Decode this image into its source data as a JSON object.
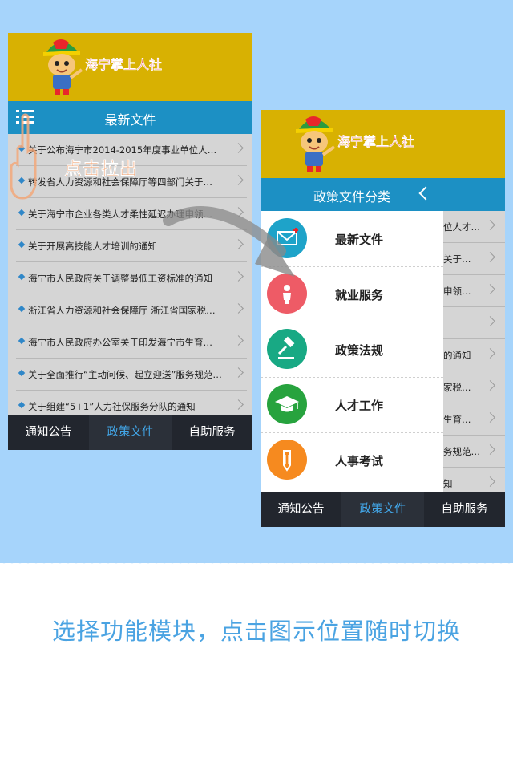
{
  "colors": {
    "background": "#a6d4fb",
    "titlebar": "#1c90c4",
    "banner": "#d8b102",
    "tabbar": "#22262e",
    "active_tab": "#42a6e8",
    "caption": "#4aa3e2"
  },
  "app_name": "海宁掌上人社",
  "phone1": {
    "title": "最新文件",
    "items": [
      "关于公布海宁市2014-2015年度事业单位人才…",
      "转发省人力资源和社会保障厅等四部门关于…",
      "关于海宁市企业各类人才柔性延迟办理申领…",
      "关于开展高技能人才培训的通知",
      "海宁市人民政府关于调整最低工资标准的通知",
      "浙江省人力资源和社会保障厅 浙江省国家税…",
      "海宁市人民政府办公室关于印发海宁市生育…",
      "关于全面推行“主动问候、起立迎送”服务规范…",
      "关于组建“5+1”人力社保服务分队的通知"
    ],
    "tabs": [
      "通知公告",
      "政策文件",
      "自助服务"
    ],
    "active_tab": "政策文件",
    "hint": "点击拉出"
  },
  "phone2": {
    "drawer_title": "政策文件分类",
    "categories": [
      {
        "label": "最新文件",
        "icon": "mail-icon",
        "color": "#1ea3c9"
      },
      {
        "label": "就业服务",
        "icon": "person-icon",
        "color": "#ee5b66"
      },
      {
        "label": "政策法规",
        "icon": "gavel-icon",
        "color": "#18a984"
      },
      {
        "label": "人才工作",
        "icon": "graduation-cap-icon",
        "color": "#27a33e"
      },
      {
        "label": "人事考试",
        "icon": "pencil-icon",
        "color": "#f68a1f"
      }
    ],
    "peek_items": [
      "位人才…",
      "关于…",
      "申领…",
      "",
      "的通知",
      "家税…",
      "生育…",
      "务规范…",
      "知"
    ],
    "tabs": [
      "通知公告",
      "政策文件",
      "自助服务"
    ],
    "active_tab": "政策文件"
  },
  "caption": "选择功能模块，点击图示位置随时切换"
}
